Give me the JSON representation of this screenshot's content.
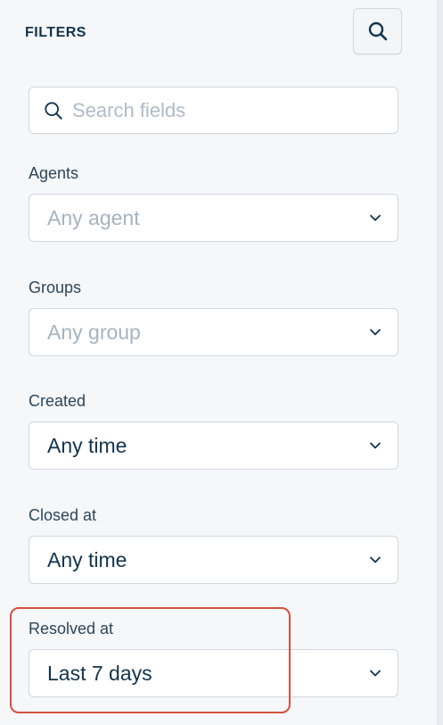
{
  "panel": {
    "title": "FILTERS",
    "header_icon": "search-icon"
  },
  "search": {
    "placeholder": "Search fields",
    "value": "",
    "icon": "search-icon"
  },
  "filters": {
    "agents": {
      "label": "Agents",
      "value": "Any agent",
      "is_placeholder": true,
      "icon": "chevron-down-icon"
    },
    "groups": {
      "label": "Groups",
      "value": "Any group",
      "is_placeholder": true,
      "icon": "chevron-down-icon"
    },
    "created": {
      "label": "Created",
      "value": "Any time",
      "is_placeholder": false,
      "icon": "chevron-down-icon"
    },
    "closed_at": {
      "label": "Closed at",
      "value": "Any time",
      "is_placeholder": false,
      "icon": "chevron-down-icon"
    },
    "resolved_at": {
      "label": "Resolved at",
      "value": "Last 7 days",
      "is_placeholder": false,
      "icon": "chevron-down-icon",
      "highlighted": true
    }
  },
  "colors": {
    "background": "#f5f7f9",
    "text": "#12344d",
    "placeholder": "#a6b3bf",
    "border": "#cfd7df",
    "highlight": "#d6503d"
  }
}
